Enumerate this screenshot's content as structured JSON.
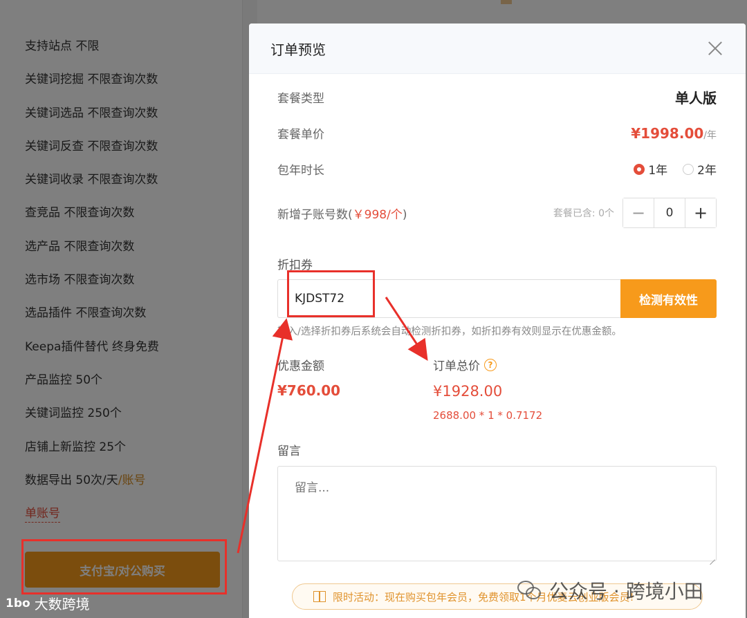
{
  "background": {
    "features": [
      {
        "text": "支持站点 不限",
        "extra": ""
      },
      {
        "text": "关键词挖掘 不限查询次数",
        "extra": ""
      },
      {
        "text": "关键词选品 不限查询次数",
        "extra": ""
      },
      {
        "text": "关键词反查 不限查询次数",
        "extra": ""
      },
      {
        "text": "关键词收录 不限查询次数",
        "extra": ""
      },
      {
        "text": "查竞品 不限查询次数",
        "extra": ""
      },
      {
        "text": "选产品 不限查询次数",
        "extra": ""
      },
      {
        "text": "选市场 不限查询次数",
        "extra": ""
      },
      {
        "text": "选品插件 不限查询次数",
        "extra": ""
      },
      {
        "text": "Keepa插件替代 终身免费",
        "extra": ""
      },
      {
        "text": "产品监控 50个",
        "extra": ""
      },
      {
        "text": "关键词监控 250个",
        "extra": ""
      },
      {
        "text": "店铺上新监控 25个",
        "extra": ""
      },
      {
        "text": "数据导出 50次/天",
        "extra": "/账号"
      }
    ],
    "single_account": "单账号",
    "pay_button": "支付宝/对公购买",
    "watermark_left": "大数跨境",
    "watermark_left_logo": "1bo"
  },
  "modal": {
    "title": "订单预览",
    "package_type_label": "套餐类型",
    "package_type_value": "单人版",
    "unit_price_label": "套餐单价",
    "unit_price_value": "¥1998.00",
    "unit_price_suffix": "/年",
    "duration_label": "包年时长",
    "duration_options": [
      "1年",
      "2年"
    ],
    "duration_selected": "1年",
    "sub_accounts_label_prefix": "新增子账号数(",
    "sub_accounts_label_price": "￥998/个",
    "sub_accounts_label_suffix": ")",
    "sub_accounts_included": "套餐已含: 0个",
    "sub_accounts_value": "0",
    "coupon_label": "折扣券",
    "coupon_value": "KJDST72",
    "check_button": "检测有效性",
    "coupon_hint": "输入/选择折扣券后系统会自动检测折扣券，如折扣券有效则显示在优惠金额。",
    "discount_label": "优惠金额",
    "discount_value": "¥760.00",
    "total_label": "订单总价",
    "total_value": "¥1928.00",
    "total_formula": "2688.00 * 1 * 0.7172",
    "remark_label": "留言",
    "remark_placeholder": "留言...",
    "promo_text": "限时活动：现在购买包年会员，免费领取1个月优麦云创业版会员!"
  },
  "watermark_right": "公众号 · 跨境小田",
  "colors": {
    "accent_orange": "#f79a1b",
    "price_red": "#e44d3a",
    "annotation_red": "#e8302a"
  }
}
